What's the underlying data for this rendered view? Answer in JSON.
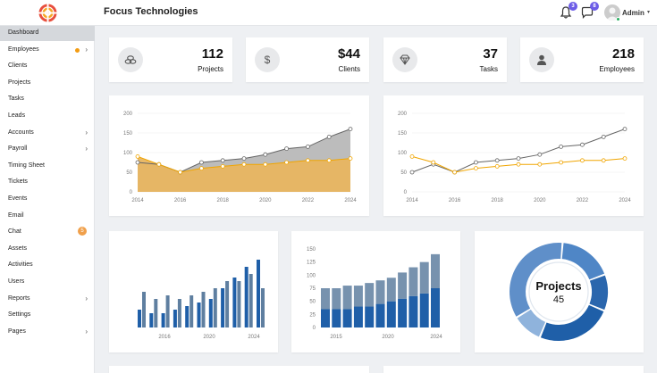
{
  "header": {
    "app_title": "Focus Technologies",
    "notifications_badge": "3",
    "messages_badge": "8",
    "user_label": "Admin",
    "logo_icon": "target-logo-icon",
    "notifications_icon": "bell-icon",
    "messages_icon": "chat-bubble-icon"
  },
  "sidebar": {
    "items": [
      {
        "label": "Dashboard",
        "active": true
      },
      {
        "label": "Employees",
        "chevron": true,
        "dot": true
      },
      {
        "label": "Clients"
      },
      {
        "label": "Projects"
      },
      {
        "label": "Tasks"
      },
      {
        "label": "Leads"
      },
      {
        "label": "Accounts",
        "chevron": true
      },
      {
        "label": "Payroll",
        "chevron": true
      },
      {
        "label": "Timing Sheet"
      },
      {
        "label": "Tickets"
      },
      {
        "label": "Events"
      },
      {
        "label": "Email"
      },
      {
        "label": "Chat",
        "count": "5"
      },
      {
        "label": "Assets"
      },
      {
        "label": "Activities"
      },
      {
        "label": "Users"
      },
      {
        "label": "Reports",
        "chevron": true
      },
      {
        "label": "Settings"
      },
      {
        "label": "Pages",
        "chevron": true
      }
    ]
  },
  "stats": [
    {
      "value": "112",
      "label": "Projects",
      "icon": "cubes-icon"
    },
    {
      "value": "$44",
      "label": "Clients",
      "icon": "dollar-icon"
    },
    {
      "value": "37",
      "label": "Tasks",
      "icon": "diamond-icon"
    },
    {
      "value": "218",
      "label": "Employees",
      "icon": "user-icon"
    }
  ],
  "colors": {
    "orange": "#f0a500",
    "orange_fill": "#e8b560",
    "gray_line": "#666666",
    "gray_fill": "#b5b5b5",
    "blue_dark": "#1f5fa8",
    "blue_mid": "#4f86c6",
    "blue_light": "#8fb3dc",
    "steel": "#5f7fa0"
  },
  "chart_data": [
    {
      "type": "area",
      "x": [
        2014,
        2015,
        2016,
        2017,
        2018,
        2019,
        2020,
        2021,
        2022,
        2023,
        2024
      ],
      "x_ticks": [
        "2014",
        "2016",
        "2018",
        "2020",
        "2022",
        "2024"
      ],
      "y_ticks": [
        "0",
        "50",
        "100",
        "150",
        "200"
      ],
      "ylim": [
        0,
        200
      ],
      "series": [
        {
          "values": [
            75,
            70,
            50,
            75,
            80,
            85,
            95,
            110,
            115,
            140,
            160
          ]
        },
        {
          "values": [
            90,
            70,
            50,
            60,
            65,
            70,
            70,
            75,
            80,
            80,
            85
          ]
        }
      ]
    },
    {
      "type": "line",
      "x": [
        2014,
        2015,
        2016,
        2017,
        2018,
        2019,
        2020,
        2021,
        2022,
        2023,
        2024
      ],
      "x_ticks": [
        "2014",
        "2016",
        "2018",
        "2020",
        "2022",
        "2024"
      ],
      "y_ticks": [
        "0",
        "50",
        "100",
        "150",
        "200"
      ],
      "ylim": [
        0,
        200
      ],
      "series": [
        {
          "values": [
            50,
            70,
            50,
            75,
            80,
            85,
            95,
            115,
            120,
            140,
            160
          ]
        },
        {
          "values": [
            90,
            75,
            50,
            60,
            65,
            70,
            70,
            75,
            80,
            80,
            85
          ]
        }
      ]
    },
    {
      "type": "bar",
      "x_ticks": [
        "2016",
        "2020",
        "2024"
      ],
      "series": [
        {
          "values": [
            25,
            20,
            20,
            25,
            30,
            35,
            40,
            55,
            70,
            85,
            95
          ]
        },
        {
          "values": [
            50,
            40,
            45,
            40,
            45,
            50,
            55,
            65,
            65,
            75,
            55
          ]
        }
      ]
    },
    {
      "type": "bar",
      "stacked": true,
      "x_ticks": [
        "2015",
        "2020",
        "2024"
      ],
      "y_ticks": [
        "0",
        "25",
        "50",
        "75",
        "100",
        "125",
        "150"
      ],
      "ylim": [
        0,
        150
      ],
      "series": [
        {
          "values": [
            35,
            35,
            35,
            40,
            40,
            45,
            50,
            55,
            60,
            65,
            75
          ]
        },
        {
          "values": [
            40,
            40,
            45,
            40,
            45,
            45,
            45,
            50,
            55,
            60,
            65
          ]
        }
      ]
    }
  ],
  "donut": {
    "title": "Projects",
    "value": "45",
    "segments": [
      {
        "value": 18,
        "color": "#4f86c6"
      },
      {
        "value": 12,
        "color": "#2a66ad"
      },
      {
        "value": 25,
        "color": "#1f5fa8"
      },
      {
        "value": 10,
        "color": "#8fb3dc"
      },
      {
        "value": 35,
        "color": "#5f8fc9"
      }
    ]
  }
}
